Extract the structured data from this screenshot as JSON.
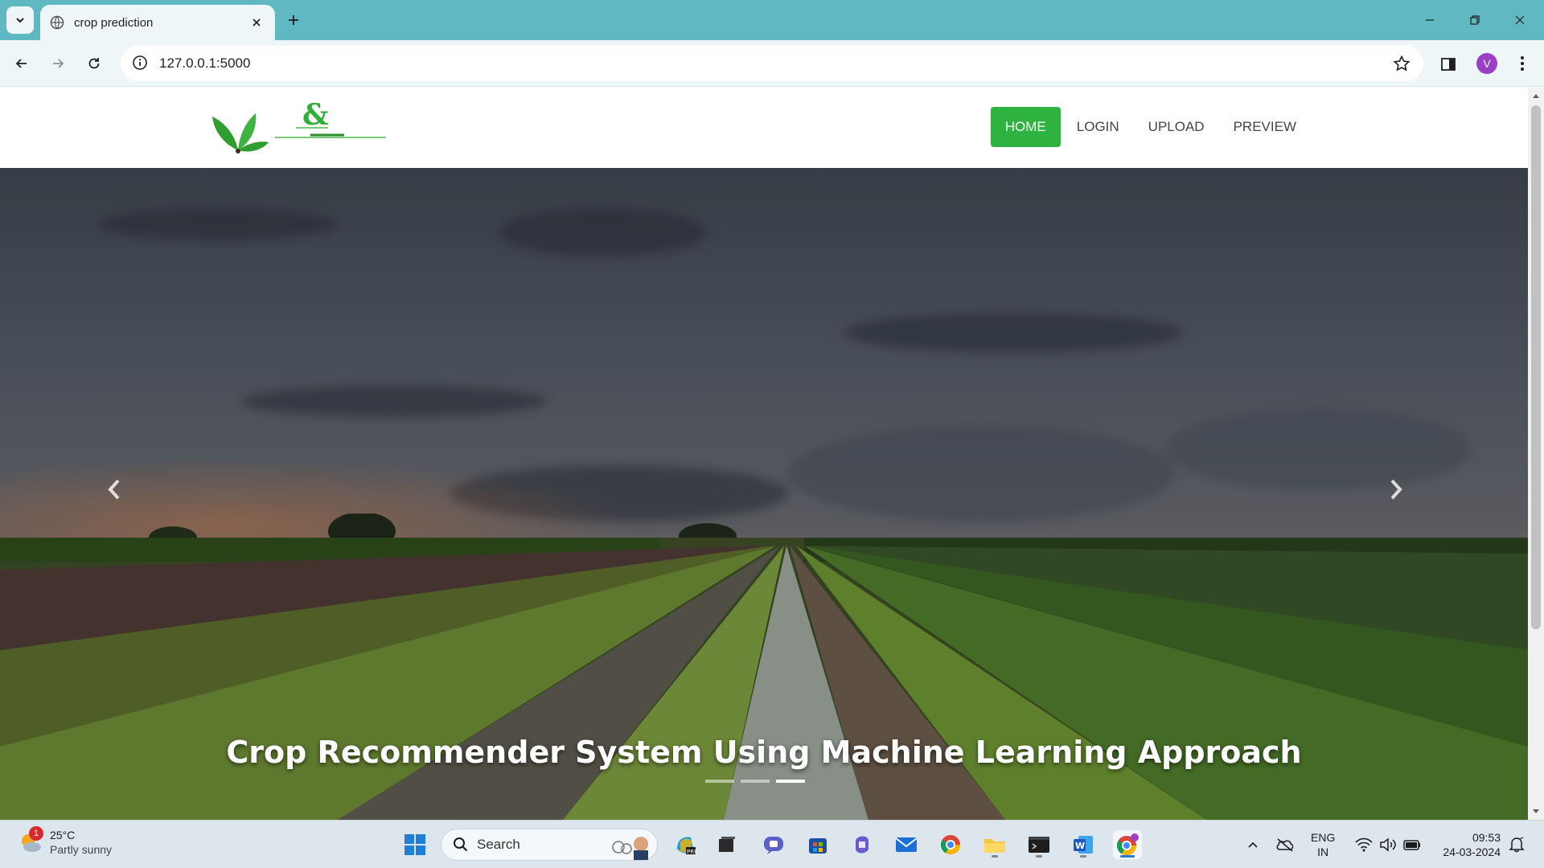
{
  "browser": {
    "tab_title": "crop prediction",
    "url": "127.0.0.1:5000",
    "profile_initial": "V"
  },
  "site": {
    "nav": [
      {
        "label": "HOME",
        "active": true
      },
      {
        "label": "LOGIN",
        "active": false
      },
      {
        "label": "UPLOAD",
        "active": false
      },
      {
        "label": "PREVIEW",
        "active": false
      }
    ],
    "hero_caption": "Crop Recommender System Using Machine Learning Approach",
    "carousel_active_index": 2,
    "carousel_count": 3
  },
  "taskbar": {
    "weather_badge": "1",
    "temperature": "25°C",
    "condition": "Partly sunny",
    "search_label": "Search",
    "lang_line1": "ENG",
    "lang_line2": "IN",
    "time": "09:53",
    "date": "24-03-2024"
  },
  "colors": {
    "titlebar": "#5fb8c2",
    "toolbar": "#eef6f7",
    "nav_active": "#2fb340",
    "profile": "#9c3fc7"
  }
}
